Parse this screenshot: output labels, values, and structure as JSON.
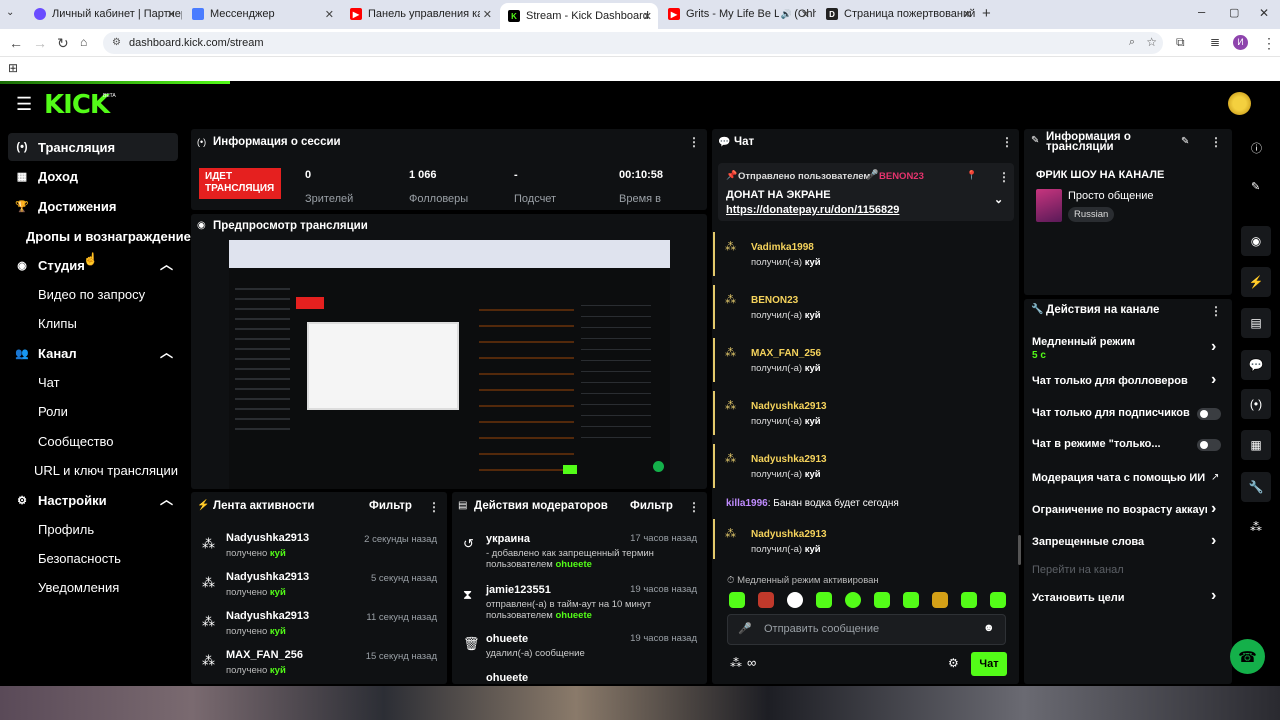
{
  "browser": {
    "tabs": [
      {
        "label": "Личный кабинет | Партнер",
        "color": "#6a4cff"
      },
      {
        "label": "Мессенджер",
        "color": "#4a7cff"
      },
      {
        "label": "Панель управления каналом",
        "color": "#ff0000"
      },
      {
        "label": "Stream - Kick Dashboard",
        "color": "#53fc18"
      },
      {
        "label": "Grits - My Life Be Like(Ohh",
        "color": "#ff0000"
      },
      {
        "label": "Страница пожертвований | D",
        "color": "#222222"
      }
    ],
    "url": "dashboard.kick.com/stream",
    "profile_initial": "И"
  },
  "brand": {
    "logo": "KICK",
    "badge": "BETA",
    "accent": "#53fc18"
  },
  "sidebar": {
    "items": [
      {
        "label": "Трансляция",
        "icon": "broadcast-icon"
      },
      {
        "label": "Доход",
        "icon": "chart-icon"
      },
      {
        "label": "Достижения",
        "icon": "trophy-icon"
      },
      {
        "label": "Дропы и вознаграждение"
      },
      {
        "label": "Студия",
        "icon": "studio-icon"
      },
      {
        "label": "Видео по запросу"
      },
      {
        "label": "Клипы"
      },
      {
        "label": "Канал",
        "icon": "users-icon"
      },
      {
        "label": "Чат"
      },
      {
        "label": "Роли"
      },
      {
        "label": "Сообщество"
      },
      {
        "label": "URL и ключ трансляции"
      },
      {
        "label": "Настройки",
        "icon": "gear-icon"
      },
      {
        "label": "Профиль"
      },
      {
        "label": "Безопасность"
      },
      {
        "label": "Уведомления"
      }
    ]
  },
  "session": {
    "title": "Информация о сессии",
    "live_badge_line1": "ИДЕТ",
    "live_badge_line2": "ТРАНСЛЯЦИЯ",
    "stats": [
      {
        "value": "0",
        "label": "Зрителей"
      },
      {
        "value": "1 066",
        "label": "Фолловеры"
      },
      {
        "value": "-",
        "label": "Подсчет"
      },
      {
        "value": "00:10:58",
        "label": "Время в"
      }
    ]
  },
  "preview": {
    "title": "Предпросмотр трансляции"
  },
  "activity": {
    "title": "Лента активности",
    "filter": "Фильтр",
    "items": [
      {
        "name": "Nadyushka2913",
        "sub_prefix": "получено ",
        "sub_item": "куй",
        "time": "2 секунды назад"
      },
      {
        "name": "Nadyushka2913",
        "sub_prefix": "получено ",
        "sub_item": "куй",
        "time": "5 секунд назад"
      },
      {
        "name": "Nadyushka2913",
        "sub_prefix": "получено ",
        "sub_item": "куй",
        "time": "11 секунд назад"
      },
      {
        "name": "MAX_FAN_256",
        "sub_prefix": "получено ",
        "sub_item": "куй",
        "time": "15 секунд назад"
      }
    ]
  },
  "moderators": {
    "title": "Действия модераторов",
    "filter": "Фильтр",
    "items": [
      {
        "name": "украина",
        "line1": "- добавлено как запрещенный термин",
        "line2_prefix": "пользователем ",
        "line2_user": "ohueete",
        "time": "17 часов назад",
        "icon": "undo-icon"
      },
      {
        "name": "jamie123551",
        "line1": "отправлен(-а) в тайм-аут на 10 минут",
        "line2_prefix": "пользователем ",
        "line2_user": "ohueete",
        "time": "19 часов назад",
        "icon": "hourglass-icon"
      },
      {
        "name": "ohueete",
        "line1": "удалил(-а) сообщение",
        "line2_prefix": "",
        "line2_user": "",
        "time": "19 часов назад",
        "icon": "trash-icon"
      },
      {
        "name": "ohueete",
        "line1": "",
        "line2_prefix": "",
        "line2_user": "",
        "time": "",
        "icon": ""
      }
    ]
  },
  "chat": {
    "title": "Чат",
    "pinned": {
      "by_label": "Отправлено пользователем",
      "user": "BENON23",
      "message": "ДОНАТ НА ЭКРАНЕ",
      "link": "https://donatepay.ru/don/1156829"
    },
    "messages": [
      {
        "name": "Vadimka1998",
        "sub": "получил(-а) ",
        "item": "куй"
      },
      {
        "name": "BENON23",
        "sub": "получил(-а) ",
        "item": "куй"
      },
      {
        "name": "MAX_FAN_256",
        "sub": "получил(-а) ",
        "item": "куй"
      },
      {
        "name": "Nadyushka2913",
        "sub": "получил(-а) ",
        "item": "куй"
      },
      {
        "name": "Nadyushka2913",
        "sub": "получил(-а) ",
        "item": "куй"
      },
      {
        "name": "Nadyushka2913",
        "sub": "получил(-а) ",
        "item": "куй"
      }
    ],
    "plain_message": {
      "user": "killa1996",
      "text": ": Банан водка будет сегодня"
    },
    "slow_mode_notice": "Медленный режим активирован",
    "input_placeholder": "Отправить сообщение",
    "send_label": "Чат"
  },
  "stream_info": {
    "title_line1": "Информация о",
    "title_line2": "трансляции",
    "stream_title": "ФРИК ШОУ НА КАНАЛЕ",
    "category": "Просто общение",
    "language": "Russian"
  },
  "channel_actions": {
    "title": "Действия на канале",
    "slow_mode": {
      "label": "Медленный режим",
      "value": "5 с"
    },
    "rows": [
      {
        "label": "Чат только для фолловеров",
        "control": "chevron"
      },
      {
        "label": "Чат только для подписчиков",
        "control": "toggle"
      },
      {
        "label": "Чат в режиме \"только...",
        "control": "toggle"
      },
      {
        "label": "Модерация чата с помощью ИИ",
        "control": "external"
      },
      {
        "label": "Ограничение по возрасту аккаунта",
        "control": "chevron"
      },
      {
        "label": "Запрещенные слова",
        "control": "chevron"
      }
    ],
    "disabled_link": "Перейти на канал",
    "goals": "Установить цели"
  }
}
